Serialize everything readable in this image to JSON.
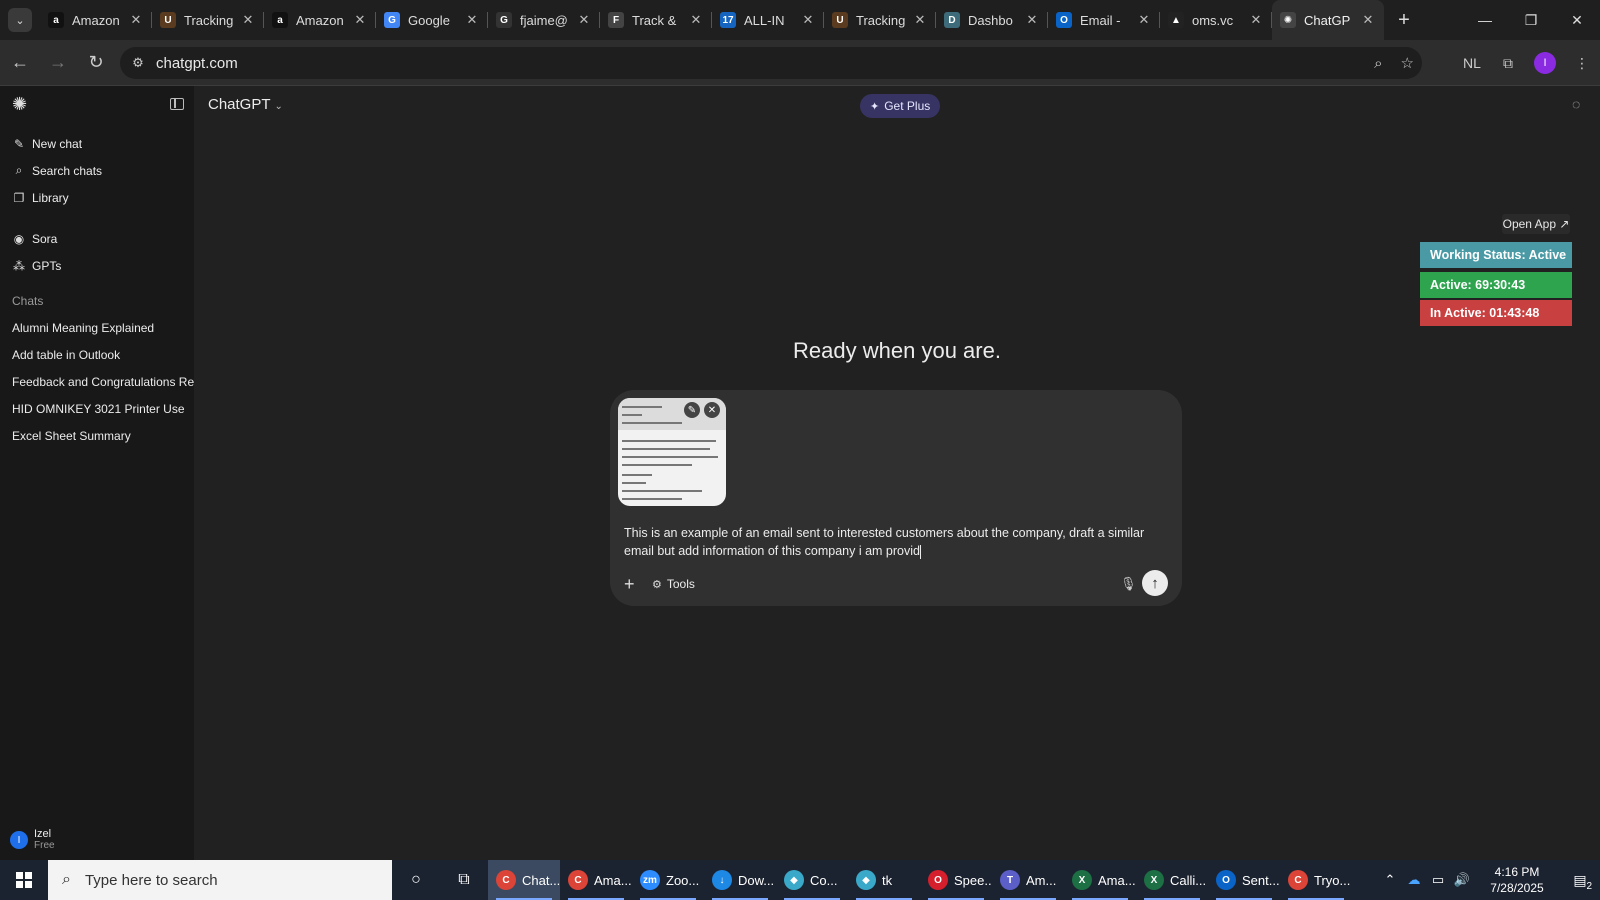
{
  "browser": {
    "tabs": [
      {
        "title": "Amazon",
        "icon": "amazon-icon",
        "color": "#111111",
        "glyph": "a"
      },
      {
        "title": "Tracking",
        "icon": "ups-icon",
        "color": "#5a3b1f",
        "glyph": "U"
      },
      {
        "title": "Amazon",
        "icon": "amazon-icon",
        "color": "#111111",
        "glyph": "a"
      },
      {
        "title": "Google",
        "icon": "google-translate-icon",
        "color": "#4285f4",
        "glyph": "G"
      },
      {
        "title": "fjaime@",
        "icon": "google-icon",
        "color": "#333333",
        "glyph": "G"
      },
      {
        "title": "Track &",
        "icon": "fedex-icon",
        "color": "#444444",
        "glyph": "F"
      },
      {
        "title": "ALL-IN",
        "icon": "17track-icon",
        "color": "#1565c0",
        "glyph": "17"
      },
      {
        "title": "Tracking",
        "icon": "ups-icon",
        "color": "#5a3b1f",
        "glyph": "U"
      },
      {
        "title": "Dashbo",
        "icon": "dashboard-icon",
        "color": "#3d6b7a",
        "glyph": "D"
      },
      {
        "title": "Email -",
        "icon": "outlook-icon",
        "color": "#0a64c8",
        "glyph": "O"
      },
      {
        "title": "oms.vc",
        "icon": "oms-icon",
        "color": "#222222",
        "glyph": "▲"
      },
      {
        "title": "ChatGP",
        "icon": "chatgpt-icon",
        "color": "#444444",
        "glyph": "✺",
        "active": true
      }
    ],
    "url": "chatgpt.com"
  },
  "sidebar": {
    "nav": [
      {
        "label": "New chat",
        "icon": "new-chat-icon",
        "glyph": "✎"
      },
      {
        "label": "Search chats",
        "icon": "search-icon",
        "glyph": "⌕"
      },
      {
        "label": "Library",
        "icon": "library-icon",
        "glyph": "❐"
      }
    ],
    "nav2": [
      {
        "label": "Sora",
        "icon": "sora-icon",
        "glyph": "◉"
      },
      {
        "label": "GPTs",
        "icon": "gpts-icon",
        "glyph": "⁂"
      }
    ],
    "chats_heading": "Chats",
    "chats": [
      "Alumni Meaning Explained",
      "Add table in Outlook",
      "Feedback and Congratulations Res...",
      "HID OMNIKEY 3021 Printer Use",
      "Excel Sheet Summary"
    ],
    "user": {
      "initial": "I",
      "name": "Izel",
      "plan": "Free"
    }
  },
  "main": {
    "model": "ChatGPT",
    "get_plus": "Get Plus",
    "headline": "Ready when you are.",
    "composer": {
      "prompt": "This is an example of an email sent to interested customers about the company, draft a similar email but add information of this company i am provid",
      "tools": "Tools"
    }
  },
  "extension": {
    "open_app": "Open App ↗",
    "working_status": "Working Status: Active",
    "active": "Active: 69:30:43",
    "inactive": "In Active: 01:43:48"
  },
  "taskbar": {
    "search_placeholder": "Type here to search",
    "apps": [
      {
        "label": "Chat...",
        "icon": "chrome-icon",
        "color": "#db4437",
        "glyph": "C",
        "active": true
      },
      {
        "label": "Ama...",
        "icon": "chrome-icon",
        "color": "#db4437",
        "glyph": "C"
      },
      {
        "label": "Zoo...",
        "icon": "zoom-icon",
        "color": "#2d8cff",
        "glyph": "zm"
      },
      {
        "label": "Dow...",
        "icon": "download-icon",
        "color": "#1e88e5",
        "glyph": "↓"
      },
      {
        "label": "Co...",
        "icon": "app-icon",
        "color": "#3aa9c9",
        "glyph": "◆"
      },
      {
        "label": "tk",
        "icon": "app-icon",
        "color": "#3aa9c9",
        "glyph": "◆"
      },
      {
        "label": "Spee...",
        "icon": "opera-icon",
        "color": "#d61f2c",
        "glyph": "O"
      },
      {
        "label": "Am...",
        "icon": "teams-icon",
        "color": "#5b5fc7",
        "glyph": "T"
      },
      {
        "label": "Ama...",
        "icon": "excel-icon",
        "color": "#1d7044",
        "glyph": "X"
      },
      {
        "label": "Calli...",
        "icon": "excel-icon",
        "color": "#1d7044",
        "glyph": "X"
      },
      {
        "label": "Sent...",
        "icon": "outlook-icon",
        "color": "#0a64c8",
        "glyph": "O"
      },
      {
        "label": "Tryo...",
        "icon": "chrome-icon",
        "color": "#db4437",
        "glyph": "C"
      }
    ],
    "time": "4:16 PM",
    "date": "7/28/2025",
    "notifications": "2"
  }
}
